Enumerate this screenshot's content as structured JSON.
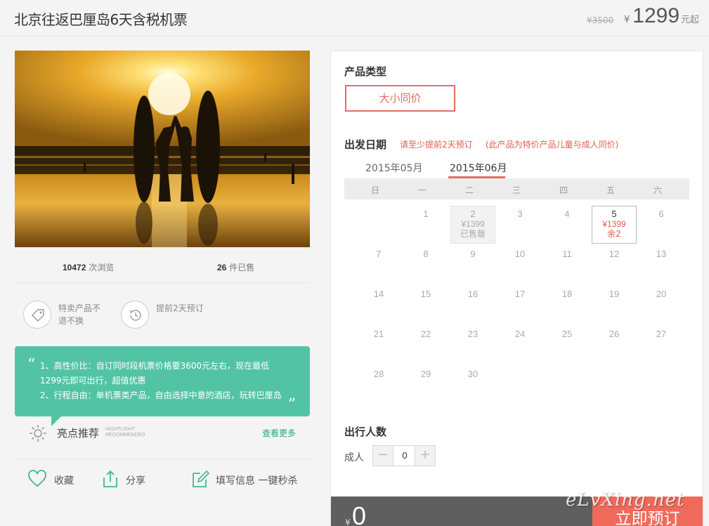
{
  "header": {
    "title": "北京往返巴厘岛6天含税机票",
    "price_original": "¥3500",
    "price_currency": "¥",
    "price_current": "1299",
    "price_unit": "元起"
  },
  "stats": {
    "views_count": "10472",
    "views_label": "次浏览",
    "sold_count": "26",
    "sold_label": "件已售"
  },
  "features": [
    {
      "icon": "tag-icon",
      "text": "特卖产品不退不换"
    },
    {
      "icon": "clock-history-icon",
      "text": "提前2天预订"
    }
  ],
  "highlights": {
    "lines": [
      "1、高性价比：自订同时段机票价格要3600元左右，现在最低",
      "1299元即可出行，超值优惠",
      "2、行程自由：单机票类产品，自由选择中意的酒店，玩转巴厘岛"
    ],
    "title": "亮点推荐",
    "en_line1": "HIGHTLIGHT",
    "en_line2": "RECOMMENDED",
    "more_label": "查看更多"
  },
  "actions": [
    {
      "icon": "heart-icon",
      "label": "收藏"
    },
    {
      "icon": "share-icon",
      "label": "分享"
    },
    {
      "icon": "edit-icon",
      "label": "填写信息 一键秒杀"
    }
  ],
  "booking": {
    "product_type_title": "产品类型",
    "product_type_option": "大小同价",
    "date_title": "出发日期",
    "note_advance": "请至少提前2天预订",
    "note_child": "(此产品为特价产品儿童与成人同价)",
    "months": [
      "2015年05月",
      "2015年06月"
    ],
    "active_month": "2015年06月",
    "weekdays": [
      "日",
      "一",
      "二",
      "三",
      "四",
      "五",
      "六"
    ],
    "special_days": {
      "2": {
        "price": "¥1399",
        "status": "已售罄"
      },
      "5": {
        "price": "¥1399",
        "status": "余2"
      }
    },
    "travelers_title": "出行人数",
    "adult_label": "成人",
    "adult_count": "0",
    "minus_symbol": "−",
    "plus_symbol": "+",
    "total_currency": "¥",
    "total_amount": "0",
    "book_label": "立即预订"
  },
  "watermark": "eLvXing.net",
  "colors": {
    "accent_red": "#e46e63",
    "green": "#52c4a4",
    "bar_gray": "#5f5f5f"
  }
}
